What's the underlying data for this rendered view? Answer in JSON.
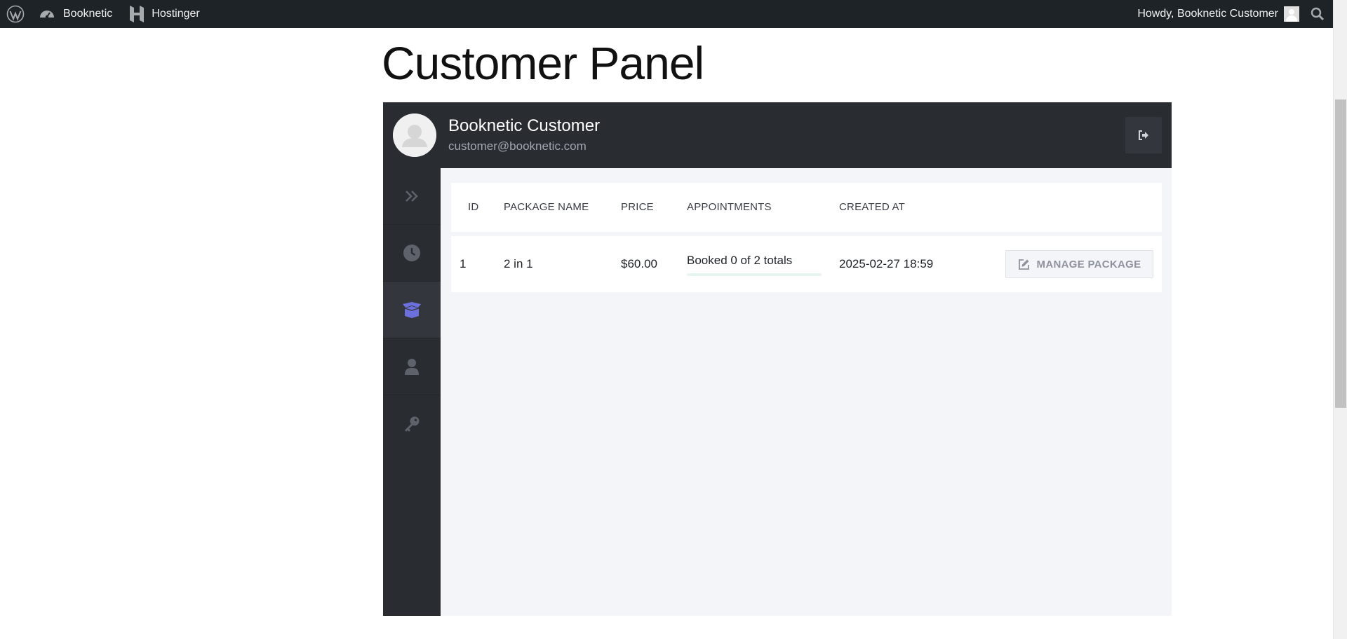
{
  "adminbar": {
    "site_items": [
      {
        "label": "Booknetic",
        "icon": "dashboard-icon"
      },
      {
        "label": "Hostinger",
        "icon": "hostinger-icon"
      }
    ],
    "greeting": "Howdy, Booknetic Customer"
  },
  "page": {
    "title": "Customer Panel"
  },
  "customer": {
    "name": "Booknetic Customer",
    "email": "customer@booknetic.com"
  },
  "sidebar": {
    "items": [
      {
        "icon": "double-chevron-right-icon",
        "active": false
      },
      {
        "icon": "clock-icon",
        "active": false
      },
      {
        "icon": "package-box-icon",
        "active": true
      },
      {
        "icon": "user-icon",
        "active": false
      },
      {
        "icon": "key-icon",
        "active": false
      }
    ]
  },
  "table": {
    "headers": [
      "ID",
      "PACKAGE NAME",
      "PRICE",
      "APPOINTMENTS",
      "CREATED AT"
    ],
    "rows": [
      {
        "id": "1",
        "package_name": "2 in 1",
        "price": "$60.00",
        "appointments": "Booked 0 of 2 totals",
        "appointments_progress": 0,
        "created_at": "2025-02-27 18:59",
        "action_label": "MANAGE PACKAGE"
      }
    ]
  },
  "colors": {
    "adminbar_bg": "#1d2327",
    "panel_dark": "#292d32",
    "accent": "#6c70dc",
    "progress": "#2ec46f"
  }
}
